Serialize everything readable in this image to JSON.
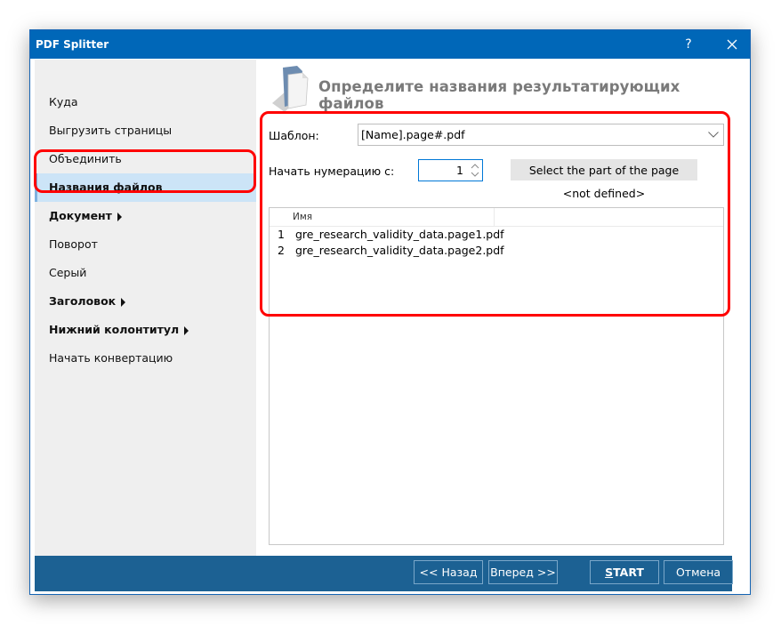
{
  "window": {
    "title": "PDF Splitter",
    "help_label": "?",
    "close_icon": "close-icon"
  },
  "sidebar": {
    "items": [
      {
        "label": "Куда",
        "bold": false,
        "arrow": false,
        "active": false
      },
      {
        "label": "Выгрузить страницы",
        "bold": false,
        "arrow": false,
        "active": false
      },
      {
        "label": "Объединить",
        "bold": false,
        "arrow": false,
        "active": false
      },
      {
        "label": "Названия файлов",
        "bold": true,
        "arrow": false,
        "active": true
      },
      {
        "label": "Документ",
        "bold": true,
        "arrow": true,
        "active": false
      },
      {
        "label": "Поворот",
        "bold": false,
        "arrow": false,
        "active": false
      },
      {
        "label": "Серый",
        "bold": false,
        "arrow": false,
        "active": false
      },
      {
        "label": "Заголовок",
        "bold": true,
        "arrow": true,
        "active": false
      },
      {
        "label": "Нижний колонтитул",
        "bold": true,
        "arrow": true,
        "active": false
      },
      {
        "label": "Начать конвертацию",
        "bold": false,
        "arrow": false,
        "active": false
      }
    ]
  },
  "header": {
    "title": "Определите названия результатирующих файлов",
    "icon": "document-icon"
  },
  "form": {
    "template_label": "Шаблон:",
    "template_value": "[Name].page#.pdf",
    "start_number_label": "Начать нумерацию с:",
    "start_number_value": "1",
    "select_part_button": "Select the part of the page",
    "part_status": "<not defined>"
  },
  "file_list": {
    "columns": [
      "Имя"
    ],
    "rows": [
      {
        "num": "1",
        "name": "gre_research_validity_data.page1.pdf"
      },
      {
        "num": "2",
        "name": "gre_research_validity_data.page2.pdf"
      }
    ]
  },
  "footer": {
    "back_label": "<< Назад",
    "next_label": "Вперед >>",
    "start_label_first": "S",
    "start_label_rest": "TART",
    "cancel_label": "Отмена"
  },
  "colors": {
    "titlebar": "#0067b8",
    "footer": "#1c6193",
    "annotation": "#ff0000",
    "active_item": "#cce4f7"
  }
}
